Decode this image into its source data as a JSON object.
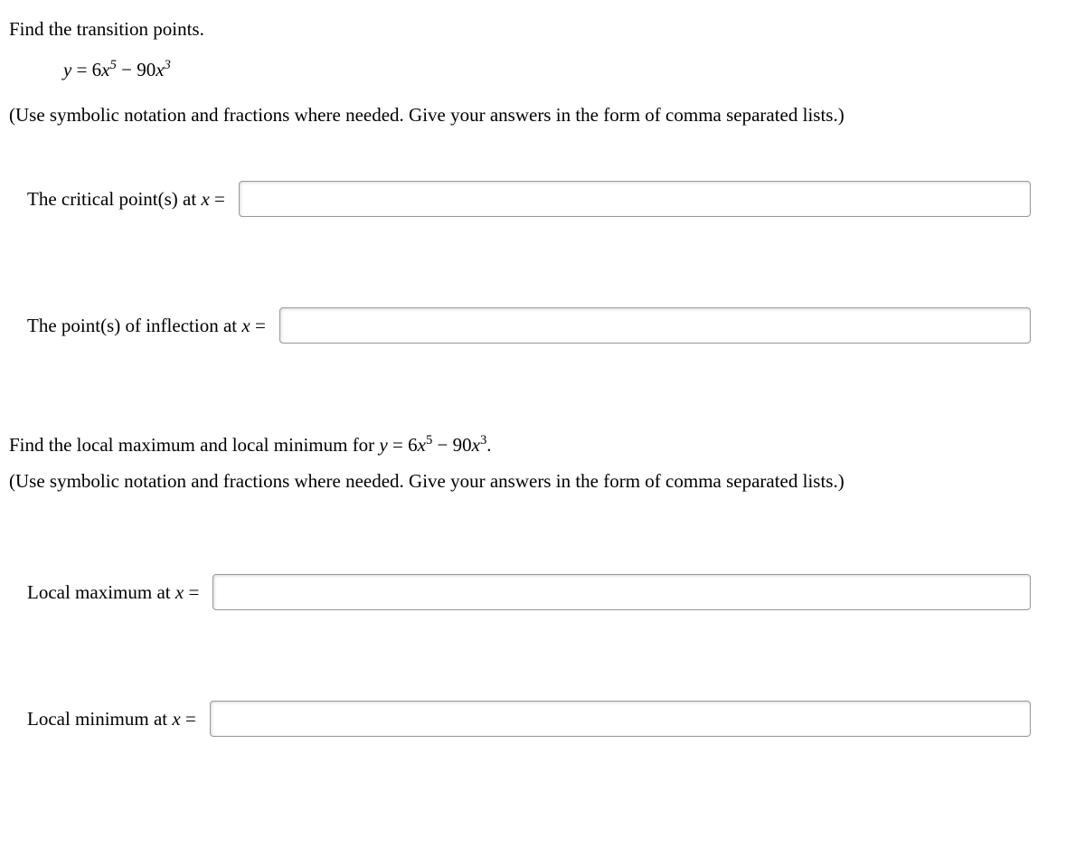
{
  "part1": {
    "prompt": "Find the transition points.",
    "equation_prefix": "y",
    "equation_eq": " = ",
    "equation_term1_coef": "6",
    "equation_term1_var": "x",
    "equation_term1_exp": "5",
    "equation_minus": " − ",
    "equation_term2_coef": "90",
    "equation_term2_var": "x",
    "equation_term2_exp": "3",
    "instruction": "(Use symbolic notation and fractions where needed. Give your answers in the form of comma separated lists.)",
    "critical_label_prefix": "The critical point(s) at ",
    "critical_label_var": "x",
    "critical_label_suffix": " =",
    "critical_value": "",
    "inflection_label_prefix": "The point(s) of inflection at ",
    "inflection_label_var": "x",
    "inflection_label_suffix": " =",
    "inflection_value": ""
  },
  "part2": {
    "prompt_prefix": "Find the local maximum and local minimum for ",
    "prompt_var_y": "y",
    "prompt_eq": " = ",
    "prompt_term1_coef": "6",
    "prompt_term1_var": "x",
    "prompt_term1_exp": "5",
    "prompt_minus": " − ",
    "prompt_term2_coef": "90",
    "prompt_term2_var": "x",
    "prompt_term2_exp": "3",
    "prompt_suffix": ".",
    "instruction": "(Use symbolic notation and fractions where needed. Give your answers in the form of comma separated lists.)",
    "localmax_label_prefix": "Local maximum at ",
    "localmax_label_var": "x",
    "localmax_label_suffix": " =",
    "localmax_value": "",
    "localmin_label_prefix": "Local minimum at ",
    "localmin_label_var": "x",
    "localmin_label_suffix": " =",
    "localmin_value": ""
  }
}
